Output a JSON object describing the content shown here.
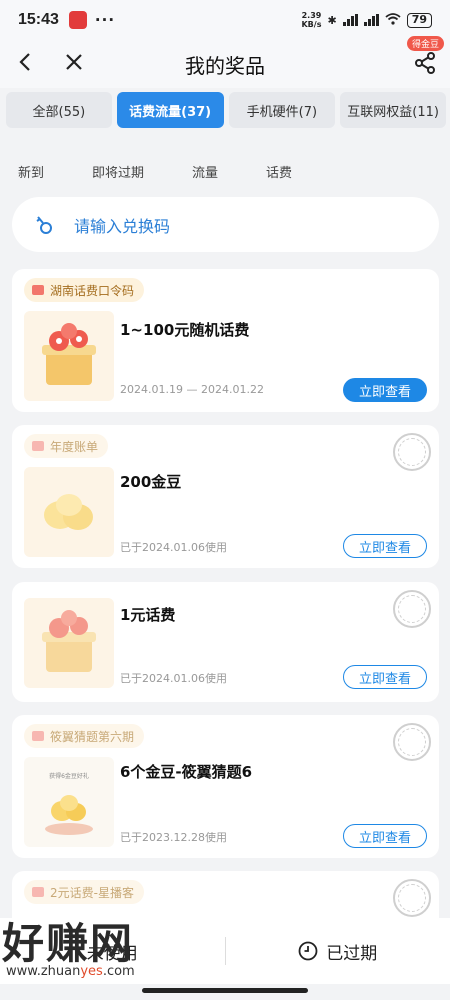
{
  "status": {
    "time": "15:43",
    "net_speed": "2.39",
    "net_unit": "KB/s",
    "battery": "79"
  },
  "header": {
    "title": "我的奖品",
    "share_badge": "得金豆"
  },
  "tabs": [
    {
      "label": "全部(55)"
    },
    {
      "label": "话费流量(37)"
    },
    {
      "label": "手机硬件(7)"
    },
    {
      "label": "互联网权益(11)"
    }
  ],
  "subtabs": [
    "新到",
    "即将过期",
    "流量",
    "话费"
  ],
  "redeem": {
    "placeholder": "请输入兑换码"
  },
  "cards": [
    {
      "tag": "湖南话费口令码",
      "name": "1~100元随机话费",
      "meta": "2024.01.19 — 2024.01.22",
      "button": "立即查看"
    },
    {
      "tag": "年度账单",
      "name": "200金豆",
      "meta": "已于2024.01.06使用",
      "button": "立即查看"
    },
    {
      "tag": "",
      "name": "1元话费",
      "meta": "已于2024.01.06使用",
      "button": "立即查看"
    },
    {
      "tag": "筱翼猜题第六期",
      "name": "6个金豆-筱翼猜题6",
      "meta": "已于2023.12.28使用",
      "button": "立即查看",
      "thumb_text": "获得6金豆好礼"
    },
    {
      "tag": "2元话费-星播客"
    }
  ],
  "bottom": {
    "unused": "未使用",
    "expired": "已过期"
  },
  "watermark": {
    "text": "好赚网",
    "url_prefix": "www.zhuan",
    "url_highlight": "yes",
    "url_suffix": ".com"
  },
  "colors": {
    "accent": "#1e88e5",
    "tag_bg": "#fdf2dd"
  }
}
